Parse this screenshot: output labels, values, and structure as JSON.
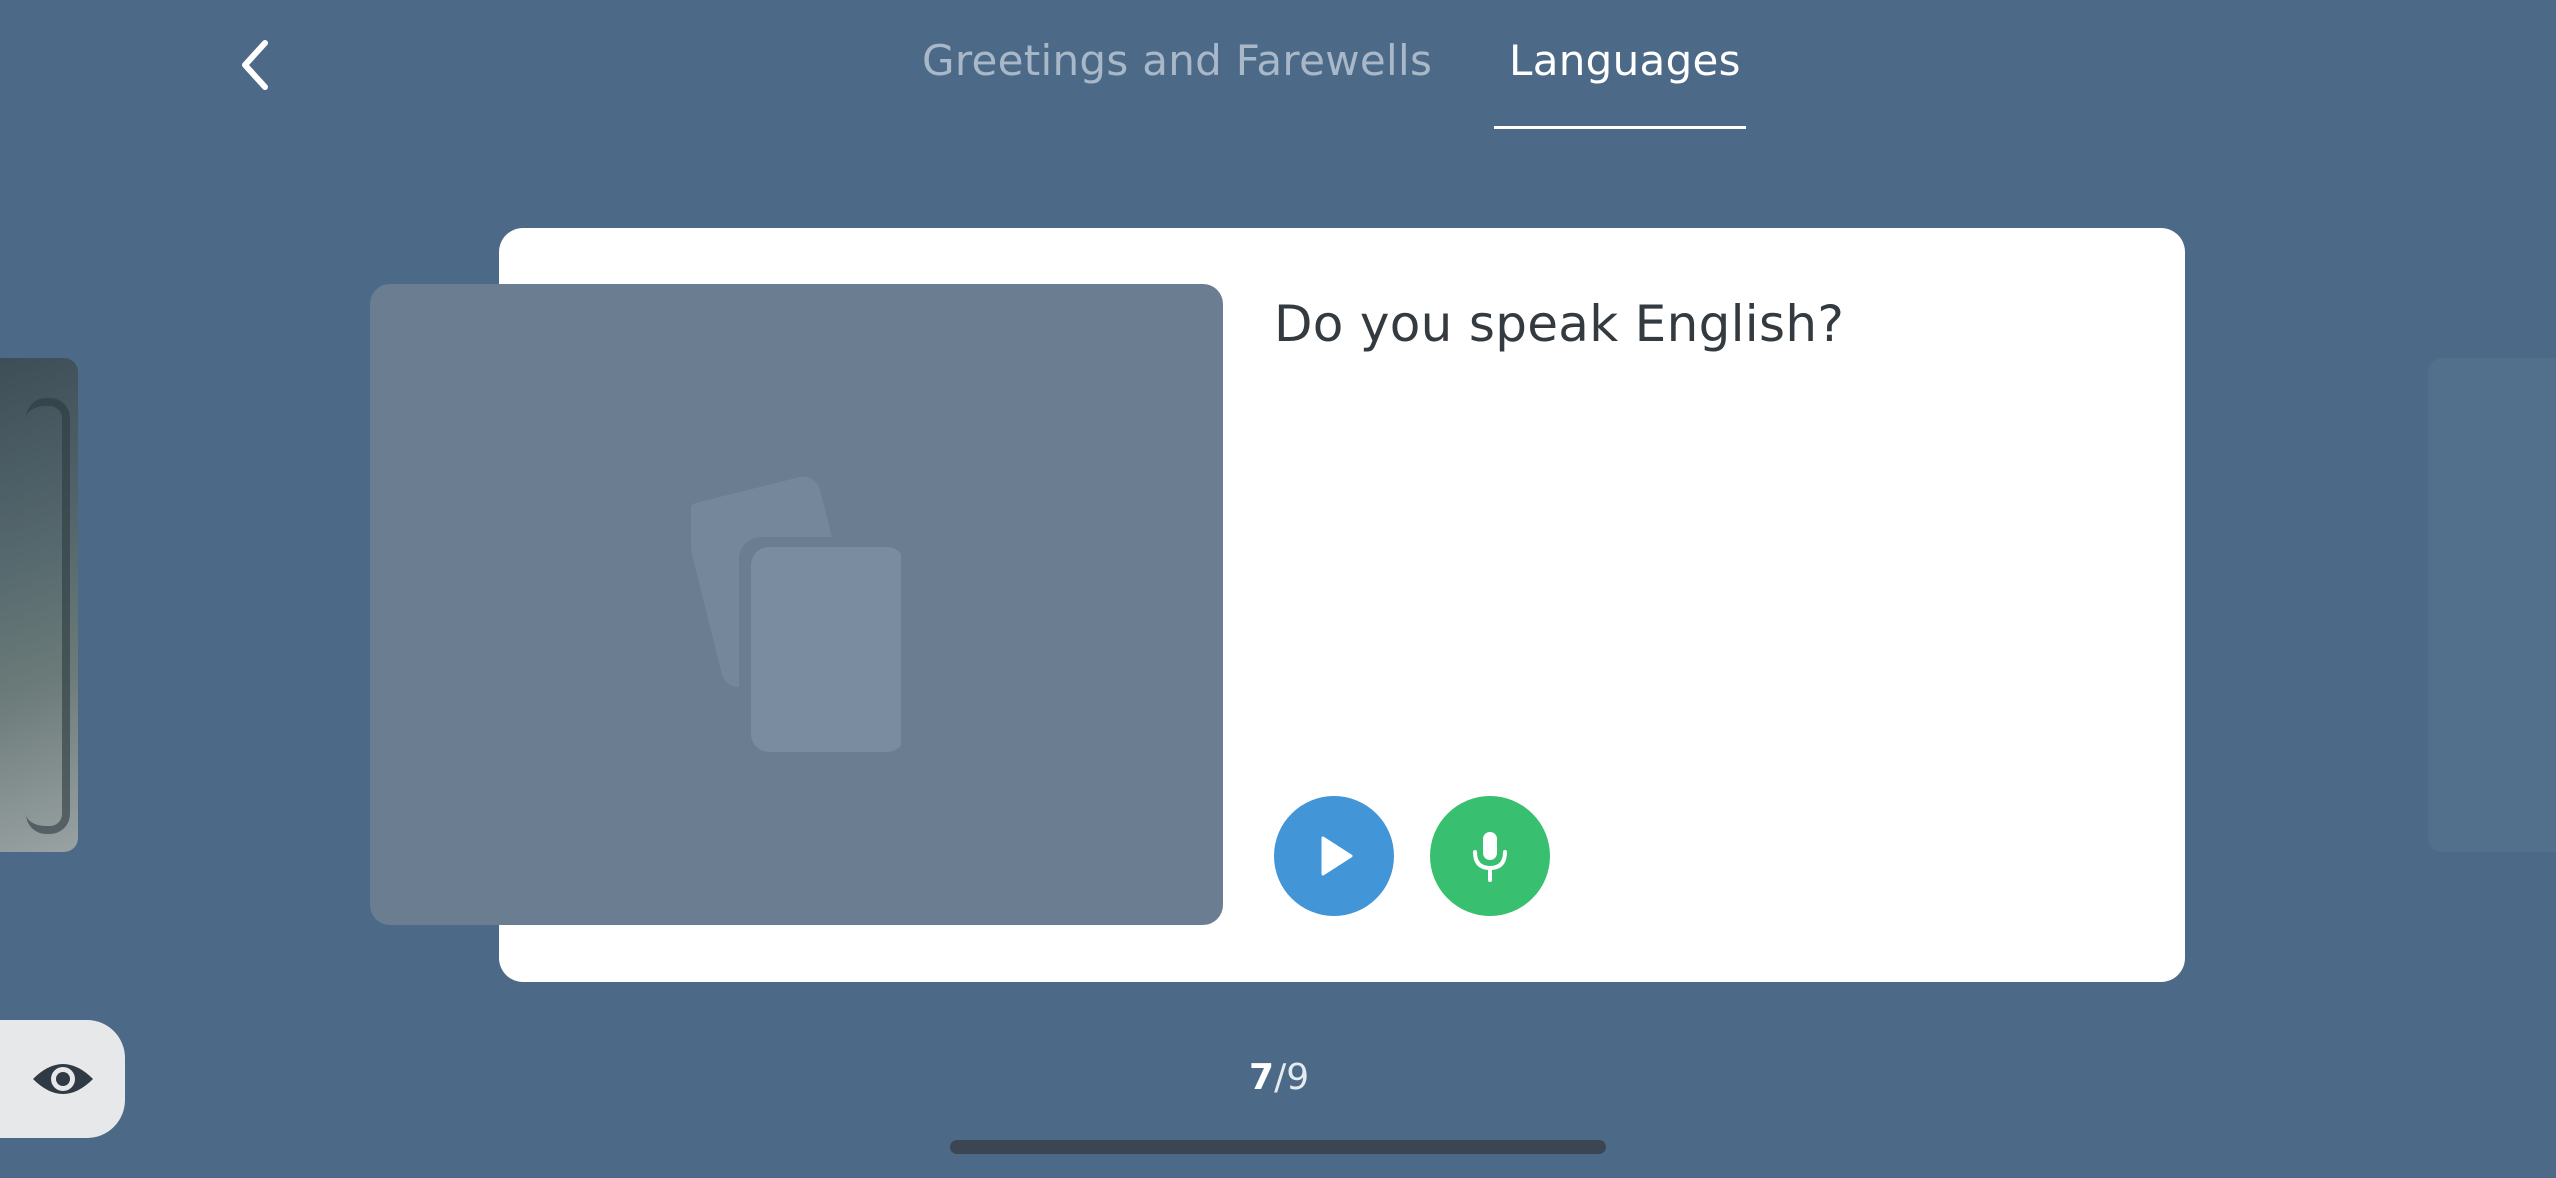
{
  "header": {
    "back_icon": "chevron-left-icon",
    "tabs": [
      {
        "label": "Greetings and Farewells",
        "active": false
      },
      {
        "label": "Languages",
        "active": true
      }
    ]
  },
  "card": {
    "image_icon": "flashcards-icon",
    "prompt": "Do you speak English?",
    "play_icon": "play-icon",
    "mic_icon": "microphone-icon"
  },
  "pager": {
    "current": "7",
    "separator": "/",
    "total": "9"
  },
  "footer": {
    "eye_icon": "eye-icon"
  },
  "colors": {
    "background": "#4c6a87",
    "card": "#ffffff",
    "image_placeholder": "#6a7d91",
    "play_button": "#4296d8",
    "mic_button": "#38c070",
    "tab_active": "#ffffff",
    "tab_inactive": "#a9b8c8"
  }
}
